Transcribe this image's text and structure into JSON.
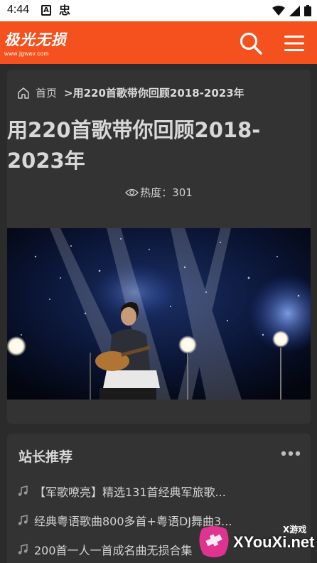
{
  "status_bar": {
    "time": "4:44",
    "icons": [
      "a-notification-icon",
      "app-notification-icon",
      "wifi-icon",
      "signal-icon",
      "battery-icon"
    ],
    "icon_a_glyph": "A",
    "icon_b_glyph": "忠"
  },
  "header": {
    "logo_text": "极光无损",
    "logo_sub": "www.jgwav.com",
    "background": "#f4511e"
  },
  "breadcrumb": {
    "home_label": "首页",
    "separator": ">",
    "current": "用220首歌带你回顾2018-2023年"
  },
  "article": {
    "title": "用220首歌带你回顾2018-2023年",
    "views_label": "热度：301"
  },
  "recommend": {
    "title": "站长推荐",
    "items": [
      "【军歌嘹亮】精选131首经典军旅歌...",
      "经典粤语歌曲800多首+粤语DJ舞曲3...",
      "200首一人一首成名曲无损合集"
    ]
  },
  "watermark": {
    "small": "X游戏",
    "text": "XYouXi.net"
  },
  "colors": {
    "accent": "#f4511e",
    "background": "#2b2b2b",
    "card": "#333333"
  }
}
